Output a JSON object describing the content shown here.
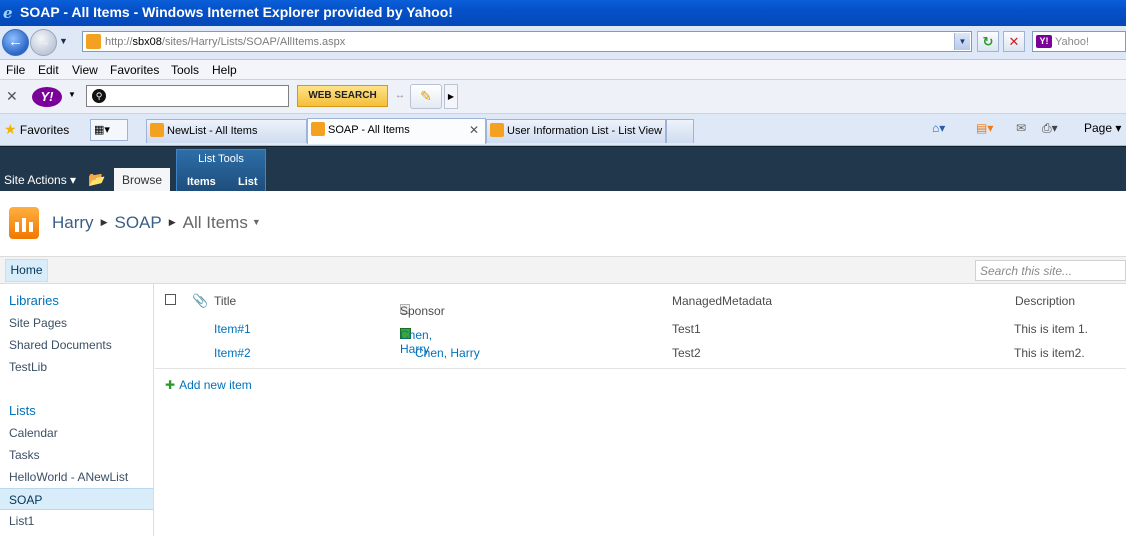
{
  "window": {
    "title": "SOAP - All Items - Windows Internet Explorer provided by Yahoo!"
  },
  "address": {
    "url_prefix": "http://",
    "url_host": "sbx08",
    "url_path": "/sites/Harry/Lists/SOAP/AllItems.aspx",
    "search_placeholder": "Yahoo!"
  },
  "menu": [
    "File",
    "Edit",
    "View",
    "Favorites",
    "Tools",
    "Help"
  ],
  "yahoo_toolbar": {
    "web_search_label": "WEB SEARCH",
    "logo": "Y!"
  },
  "tabs": {
    "favorites_label": "Favorites",
    "items": [
      "NewList - All Items",
      "SOAP - All Items",
      "User Information List - List View"
    ],
    "page_label": "Page"
  },
  "ribbon": {
    "site_actions": "Site Actions",
    "browse": "Browse",
    "list_tools": "List Tools",
    "items": "Items",
    "list": "List"
  },
  "breadcrumb": {
    "site": "Harry",
    "list": "SOAP",
    "view": "All Items"
  },
  "topnav": {
    "home": "Home",
    "search_placeholder": "Search this site..."
  },
  "leftnav": {
    "libraries_header": "Libraries",
    "libraries": [
      "Site Pages",
      "Shared Documents",
      "TestLib"
    ],
    "lists_header": "Lists",
    "lists": [
      "Calendar",
      "Tasks",
      "HelloWorld - ANewList",
      "SOAP",
      "List1"
    ],
    "selected": "SOAP"
  },
  "listview": {
    "columns": {
      "title": "Title",
      "sponsor": "Sponsor",
      "managed_metadata": "ManagedMetadata",
      "description": "Description"
    },
    "rows": [
      {
        "title": "Item#1",
        "sponsor": "Chen, Harry",
        "managed_metadata": "Test1",
        "description": "This is item 1."
      },
      {
        "title": "Item#2",
        "sponsor": "Chen, Harry",
        "managed_metadata": "Test2",
        "description": "This is item2."
      }
    ],
    "add_new": "Add new item"
  }
}
